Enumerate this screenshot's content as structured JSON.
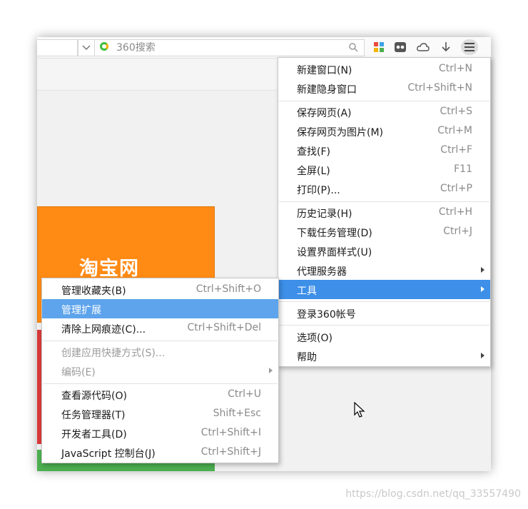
{
  "search": {
    "placeholder": "360搜索"
  },
  "toolbar_icons": [
    "apps-grid-icon",
    "ghost-mode-icon",
    "cloud-icon",
    "download-icon",
    "menu-icon"
  ],
  "page": {
    "card_logo_text": "淘宝网"
  },
  "main_menu": [
    {
      "label": "新建窗口(N)",
      "shortcut": "Ctrl+N"
    },
    {
      "label": "新建隐身窗口",
      "shortcut": "Ctrl+Shift+N"
    },
    {
      "label": "保存网页(A)",
      "shortcut": "Ctrl+S"
    },
    {
      "label": "保存网页为图片(M)",
      "shortcut": "Ctrl+M"
    },
    {
      "label": "查找(F)",
      "shortcut": "Ctrl+F"
    },
    {
      "label": "全屏(L)",
      "shortcut": "F11"
    },
    {
      "label": "打印(P)...",
      "shortcut": "Ctrl+P"
    },
    {
      "label": "历史记录(H)",
      "shortcut": "Ctrl+H"
    },
    {
      "label": "下载任务管理(D)",
      "shortcut": "Ctrl+J"
    },
    {
      "label": "设置界面样式(U)",
      "shortcut": ""
    },
    {
      "label": "代理服务器",
      "shortcut": "",
      "submenu": true
    },
    {
      "label": "工具",
      "shortcut": "",
      "submenu": true,
      "active": true
    },
    {
      "label": "登录360帐号",
      "shortcut": ""
    },
    {
      "label": "选项(O)",
      "shortcut": ""
    },
    {
      "label": "帮助",
      "shortcut": "",
      "submenu": true
    }
  ],
  "tools_submenu": [
    {
      "label": "管理收藏夹(B)",
      "shortcut": "Ctrl+Shift+O"
    },
    {
      "label": "管理扩展",
      "shortcut": "",
      "hover": true
    },
    {
      "label": "清除上网痕迹(C)...",
      "shortcut": "Ctrl+Shift+Del"
    },
    {
      "label": "创建应用快捷方式(S)...",
      "shortcut": "",
      "disabled": true
    },
    {
      "label": "编码(E)",
      "shortcut": "",
      "disabled": true,
      "submenu": true
    },
    {
      "label": "查看源代码(O)",
      "shortcut": "Ctrl+U"
    },
    {
      "label": "任务管理器(T)",
      "shortcut": "Shift+Esc"
    },
    {
      "label": "开发者工具(D)",
      "shortcut": "Ctrl+Shift+I"
    },
    {
      "label": "JavaScript 控制台(J)",
      "shortcut": "Ctrl+Shift+J"
    }
  ],
  "watermark": "https://blog.csdn.net/qq_33557490",
  "colors": {
    "active": "#3d8fe8",
    "hover": "#5ea4ec",
    "card": "#ff8a14"
  }
}
